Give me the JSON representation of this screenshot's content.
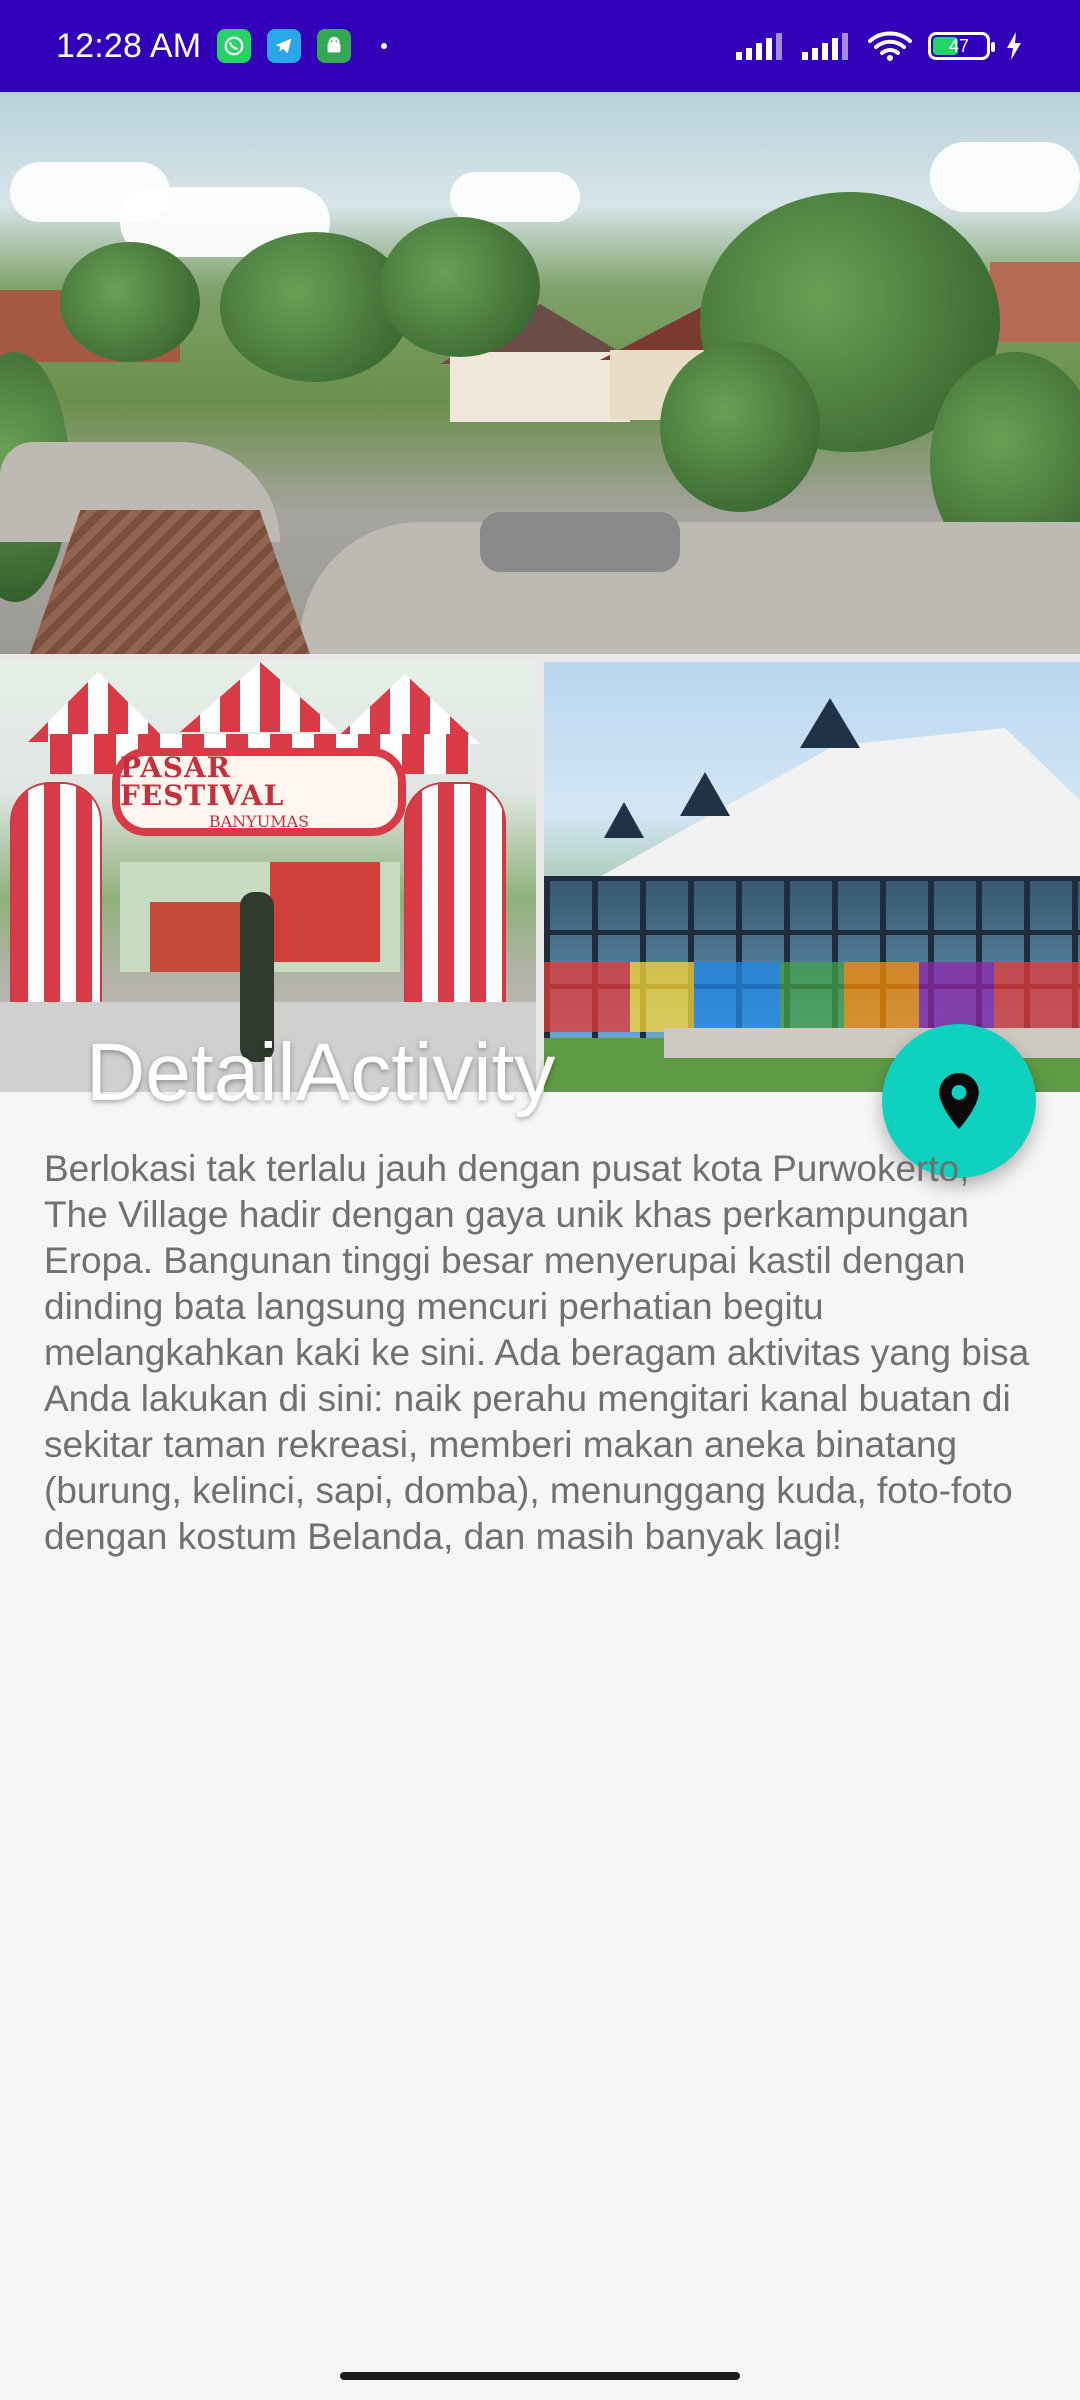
{
  "status_bar": {
    "time": "12:28 AM",
    "battery_level": "47",
    "icons": [
      "whatsapp-icon",
      "telegram-icon",
      "android-icon",
      "signal-icon",
      "signal-icon",
      "wifi-icon",
      "battery-icon",
      "charging-icon"
    ]
  },
  "header": {
    "title": "DetailActivity",
    "sign_text_main": "PASAR FESTIVAL",
    "sign_text_sub": "BANYUMAS"
  },
  "fab": {
    "icon": "location-pin-icon",
    "color": "#0fd1bf"
  },
  "content": {
    "description": "Berlokasi tak terlalu jauh dengan pusat kota Purwokerto, The Village hadir dengan gaya unik khas perkampungan Eropa. Bangunan tinggi besar menyerupai kastil dengan dinding bata langsung mencuri perhatian begitu melangkahkan kaki ke sini. Ada beragam aktivitas yang bisa Anda lakukan di sini: naik perahu mengitari kanal buatan di sekitar taman rekreasi, memberi makan aneka binatang (burung, kelinci, sapi, domba), menunggang kuda, foto-foto dengan kostum Belanda, dan masih banyak lagi!"
  },
  "colors": {
    "status_bar": "#3100b8",
    "background": "#f6f6f6",
    "text": "#707070"
  }
}
